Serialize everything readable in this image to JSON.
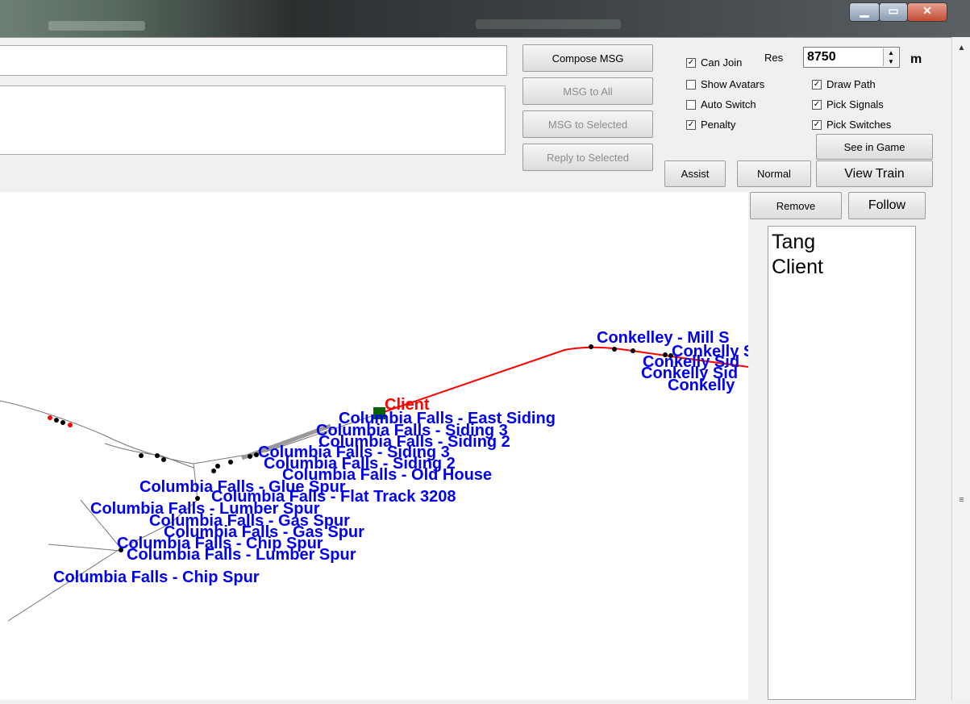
{
  "panel": {
    "compose_label": "Compose MSG",
    "msg_all_label": "MSG to All",
    "msg_selected_label": "MSG to Selected",
    "reply_selected_label": "Reply to Selected",
    "can_join_label": "Can Join",
    "res_label": "Res",
    "res_value": "8750",
    "res_unit": "m",
    "show_avatars_label": "Show Avatars",
    "auto_switch_label": "Auto Switch",
    "penalty_label": "Penalty",
    "draw_path_label": "Draw Path",
    "pick_signals_label": "Pick Signals",
    "pick_switches_label": "Pick Switches",
    "see_in_game_label": "See in Game",
    "assist_label": "Assist",
    "normal_label": "Normal",
    "view_train_label": "View Train",
    "remove_label": "Remove",
    "follow_label": "Follow"
  },
  "checkboxes": {
    "can_join": true,
    "show_avatars": false,
    "auto_switch": false,
    "penalty": true,
    "draw_path": true,
    "pick_signals": true,
    "pick_switches": true
  },
  "players": [
    "Tang",
    "Client"
  ],
  "map": {
    "train_label": "Client",
    "labels": [
      "Conkelley - Mill S",
      "Conkelly Si",
      "Conkelly Sid",
      "Conkelly Sid",
      "Conkelly",
      "Columbia Falls - East Siding",
      "Columbia Falls - Siding 3",
      "Columbia Falls - Siding 2",
      "Columbia Falls - Siding 3",
      "Columbia Falls - Siding 2",
      "Columbia Falls - Old House",
      "Columbia Falls - Glue Spur",
      "Columbia Falls - Flat Track 3208",
      "Columbia Falls - Lumber Spur",
      "Columbia Falls - Gas Spur",
      "Columbia Falls - Gas Spur",
      "Columbia Falls - Chip Spur",
      "Columbia Falls -  Lumber Spur",
      "Columbia Falls -  Chip Spur"
    ]
  },
  "colors": {
    "label_blue": "#0000ee",
    "path_red": "#ff0000",
    "train_green": "#006400"
  }
}
